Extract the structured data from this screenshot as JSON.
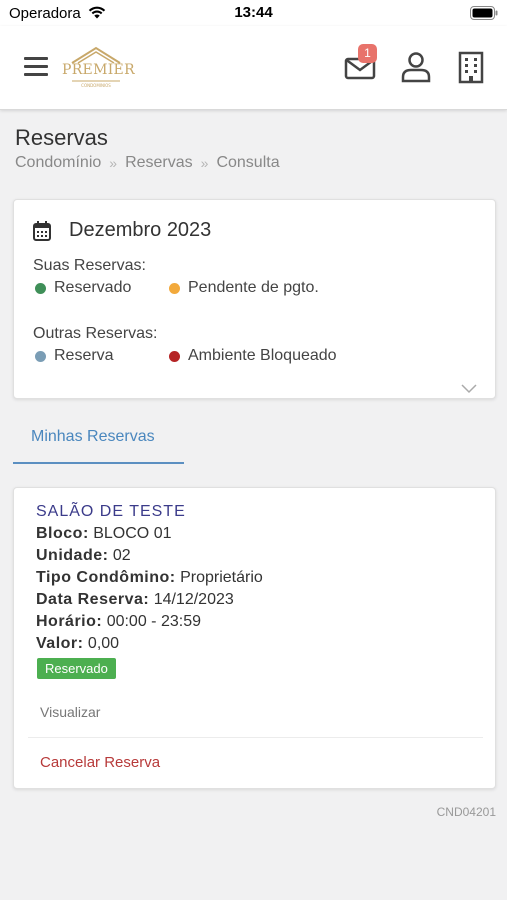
{
  "status_bar": {
    "carrier": "Operadora",
    "time": "13:44"
  },
  "header": {
    "logo_text": "PREMIER",
    "notification_count": "1"
  },
  "page": {
    "title": "Reservas",
    "breadcrumb": [
      "Condomínio",
      "Reservas",
      "Consulta"
    ]
  },
  "calendar": {
    "month": "Dezembro 2023",
    "own_title": "Suas Reservas:",
    "own_items": [
      {
        "label": "Reservado",
        "color": "#3f8f58"
      },
      {
        "label": "Pendente de pgto.",
        "color": "#f2a93b"
      }
    ],
    "other_title": "Outras Reservas:",
    "other_items": [
      {
        "label": "Reserva",
        "color": "#7a9db5"
      },
      {
        "label": "Ambiente Bloqueado",
        "color": "#b52425"
      }
    ]
  },
  "tabs": [
    {
      "label": "Minhas Reservas",
      "active": true
    }
  ],
  "reservation": {
    "title": "SALÃO DE TESTE",
    "fields": [
      {
        "label": "Bloco:",
        "value": "BLOCO 01"
      },
      {
        "label": "Unidade:",
        "value": "02"
      },
      {
        "label": "Tipo Condômino:",
        "value": "Proprietário"
      },
      {
        "label": "Data Reserva:",
        "value": "14/12/2023"
      },
      {
        "label": "Horário:",
        "value": "00:00 - 23:59"
      },
      {
        "label": "Valor:",
        "value": "0,00"
      }
    ],
    "status": "Reservado",
    "view_label": "Visualizar",
    "cancel_label": "Cancelar Reserva"
  },
  "footer_code": "CND04201"
}
